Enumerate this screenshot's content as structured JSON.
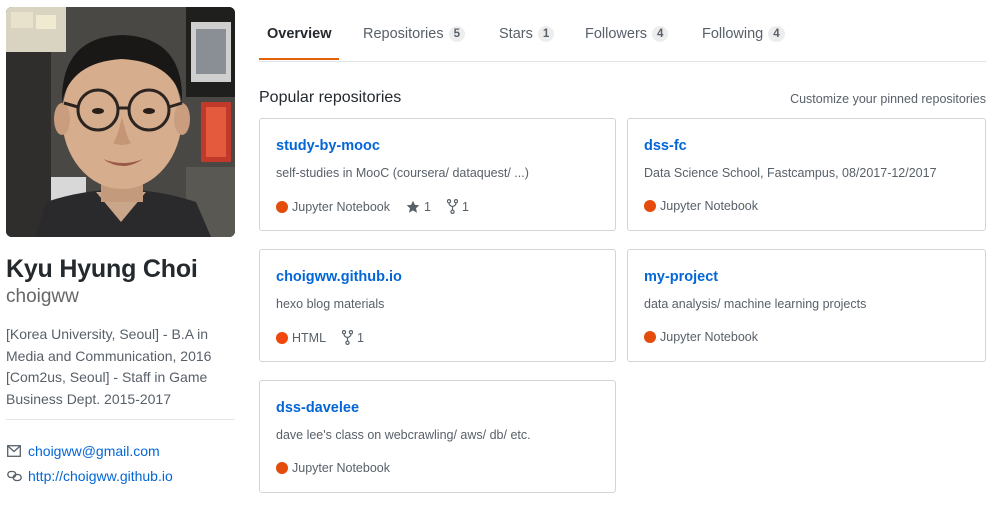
{
  "profile": {
    "fullname": "Kyu Hyung Choi",
    "username": "choigww",
    "bio_lines": [
      "[Korea University, Seoul] - B.A in",
      "Media and Communication, 2016",
      "[Com2us, Seoul] - Staff in Game",
      "Business Dept. 2015-2017"
    ],
    "email": "choigww@gmail.com",
    "website": "http://choigww.github.io"
  },
  "tabs": [
    {
      "label": "Overview",
      "count": null,
      "selected": true
    },
    {
      "label": "Repositories",
      "count": "5"
    },
    {
      "label": "Stars",
      "count": "1"
    },
    {
      "label": "Followers",
      "count": "4"
    },
    {
      "label": "Following",
      "count": "4"
    }
  ],
  "section": {
    "title": "Popular repositories",
    "customize_link": "Customize your pinned repositories"
  },
  "colors": {
    "accent_tab": "#e36209",
    "link": "#0366d6",
    "jupyter_notebook": "#DA5B0B",
    "html": "#e34c26"
  },
  "repos": [
    {
      "name": "study-by-mooc",
      "description": "self-studies in MooC (coursera/ dataquest/ ...)",
      "language": "Jupyter Notebook",
      "stars": "1",
      "forks": "1"
    },
    {
      "name": "dss-fc",
      "description": "Data Science School, Fastcampus, 08/2017-12/2017",
      "language": "Jupyter Notebook"
    },
    {
      "name": "choigww.github.io",
      "description": "hexo blog materials",
      "language": "HTML",
      "forks": "1"
    },
    {
      "name": "my-project",
      "description": "data analysis/ machine learning projects",
      "language": "Jupyter Notebook"
    },
    {
      "name": "dss-davelee",
      "description": "dave lee's class on webcrawling/ aws/ db/ etc.",
      "language": "Jupyter Notebook"
    }
  ]
}
